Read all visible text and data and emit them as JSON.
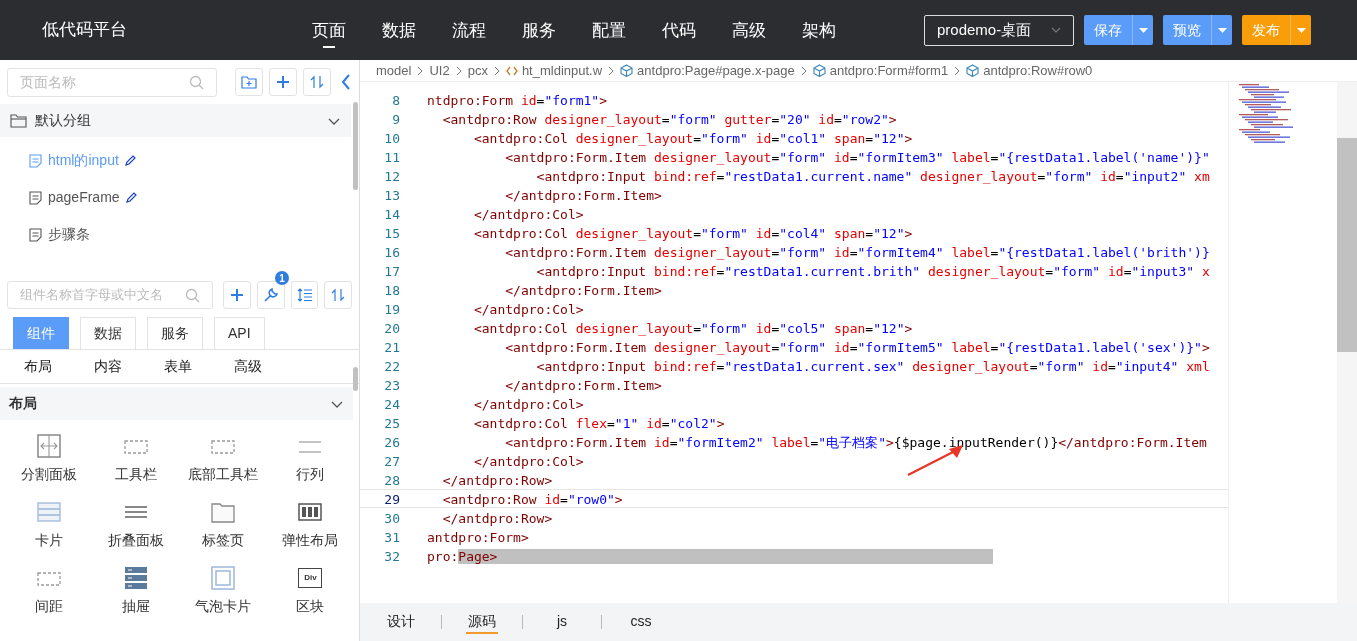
{
  "header": {
    "title": "低代码平台",
    "nav": [
      {
        "label": "页面",
        "selected": true
      },
      {
        "label": "数据",
        "selected": false
      },
      {
        "label": "流程",
        "selected": false
      },
      {
        "label": "服务",
        "selected": false
      },
      {
        "label": "配置",
        "selected": false
      },
      {
        "label": "代码",
        "selected": false
      },
      {
        "label": "高级",
        "selected": false
      },
      {
        "label": "架构",
        "selected": false
      }
    ],
    "project_select": "prodemo-桌面",
    "buttons": [
      {
        "label": "保存",
        "kind": "blue"
      },
      {
        "label": "预览",
        "kind": "blue"
      },
      {
        "label": "发布",
        "kind": "orange"
      }
    ]
  },
  "pages_panel": {
    "search": {
      "placeholder": "页面名称"
    },
    "group": {
      "label": "默认分组",
      "expanded": true,
      "items": [
        {
          "label": "html的input",
          "selected": true,
          "editable": true
        },
        {
          "label": "pageFrame",
          "selected": false,
          "editable": true
        },
        {
          "label": "步骤条",
          "selected": false,
          "editable": false
        }
      ]
    }
  },
  "components_panel": {
    "search": {
      "placeholder": "组件名称首字母或中文名"
    },
    "tool_badge": "1",
    "tabs": [
      {
        "label": "组件",
        "selected": true
      },
      {
        "label": "数据",
        "selected": false
      },
      {
        "label": "服务",
        "selected": false
      },
      {
        "label": "API",
        "selected": false
      }
    ],
    "categories": [
      "布局",
      "内容",
      "表单",
      "高级"
    ],
    "section": {
      "title": "布局",
      "expanded": true,
      "items": [
        {
          "label": "分割面板",
          "kind": "split"
        },
        {
          "label": "工具栏",
          "kind": "dashed"
        },
        {
          "label": "底部工具栏",
          "kind": "dashed"
        },
        {
          "label": "行列",
          "kind": "lines"
        },
        {
          "label": "卡片",
          "kind": "card"
        },
        {
          "label": "折叠面板",
          "kind": "bars"
        },
        {
          "label": "标签页",
          "kind": "folder"
        },
        {
          "label": "弹性布局",
          "kind": "columns"
        },
        {
          "label": "间距",
          "kind": "dashed"
        },
        {
          "label": "抽屉",
          "kind": "drawer"
        },
        {
          "label": "气泡卡片",
          "kind": "frame"
        },
        {
          "label": "区块",
          "kind": "div",
          "icon_text": "Div"
        }
      ]
    }
  },
  "breadcrumb": [
    {
      "label": "model",
      "kind": "plain"
    },
    {
      "label": "UI2",
      "kind": "plain"
    },
    {
      "label": "pcx",
      "kind": "plain"
    },
    {
      "label": "ht_mldinput.w",
      "kind": "file"
    },
    {
      "label": "antdpro:Page#page.x-page",
      "kind": "component"
    },
    {
      "label": "antdpro:Form#form1",
      "kind": "component"
    },
    {
      "label": "antdpro:Row#row0",
      "kind": "component"
    }
  ],
  "editor": {
    "lines": [
      {
        "number": "8",
        "current": false,
        "tokens": [
          {
            "kind": "tag",
            "text": "ntdpro:Form"
          },
          {
            "kind": "attr",
            "text": " id"
          },
          {
            "kind": "text",
            "text": "="
          },
          {
            "kind": "value",
            "text": "\"form1\""
          },
          {
            "kind": "tag",
            "text": ">"
          }
        ]
      },
      {
        "number": "9",
        "current": false,
        "tokens": [
          {
            "kind": "tag",
            "text": "  <antdpro:Row"
          },
          {
            "kind": "attr",
            "text": " designer_layout"
          },
          {
            "kind": "text",
            "text": "="
          },
          {
            "kind": "value",
            "text": "\"form\""
          },
          {
            "kind": "attr",
            "text": " gutter"
          },
          {
            "kind": "text",
            "text": "="
          },
          {
            "kind": "value",
            "text": "\"20\""
          },
          {
            "kind": "attr",
            "text": " id"
          },
          {
            "kind": "text",
            "text": "="
          },
          {
            "kind": "value",
            "text": "\"row2\""
          },
          {
            "kind": "tag",
            "text": ">"
          }
        ]
      },
      {
        "number": "10",
        "current": false,
        "tokens": [
          {
            "kind": "tag",
            "text": "      <antdpro:Col"
          },
          {
            "kind": "attr",
            "text": " designer_layout"
          },
          {
            "kind": "text",
            "text": "="
          },
          {
            "kind": "value",
            "text": "\"form\""
          },
          {
            "kind": "attr",
            "text": " id"
          },
          {
            "kind": "text",
            "text": "="
          },
          {
            "kind": "value",
            "text": "\"col1\""
          },
          {
            "kind": "attr",
            "text": " span"
          },
          {
            "kind": "text",
            "text": "="
          },
          {
            "kind": "value",
            "text": "\"12\""
          },
          {
            "kind": "tag",
            "text": ">"
          }
        ]
      },
      {
        "number": "11",
        "current": false,
        "tokens": [
          {
            "kind": "tag",
            "text": "          <antdpro:Form.Item"
          },
          {
            "kind": "attr",
            "text": " designer_layout"
          },
          {
            "kind": "text",
            "text": "="
          },
          {
            "kind": "value",
            "text": "\"form\""
          },
          {
            "kind": "attr",
            "text": " id"
          },
          {
            "kind": "text",
            "text": "="
          },
          {
            "kind": "value",
            "text": "\"formItem3\""
          },
          {
            "kind": "attr",
            "text": " label"
          },
          {
            "kind": "text",
            "text": "="
          },
          {
            "kind": "value",
            "text": "\"{restData1.label('name')}\""
          }
        ]
      },
      {
        "number": "12",
        "current": false,
        "tokens": [
          {
            "kind": "tag",
            "text": "              <antdpro:Input"
          },
          {
            "kind": "attr",
            "text": " bind:ref"
          },
          {
            "kind": "text",
            "text": "="
          },
          {
            "kind": "value",
            "text": "\"restData1.current.name\""
          },
          {
            "kind": "attr",
            "text": " designer_layout"
          },
          {
            "kind": "text",
            "text": "="
          },
          {
            "kind": "value",
            "text": "\"form\""
          },
          {
            "kind": "attr",
            "text": " id"
          },
          {
            "kind": "text",
            "text": "="
          },
          {
            "kind": "value",
            "text": "\"input2\""
          },
          {
            "kind": "attr",
            "text": " xm"
          }
        ]
      },
      {
        "number": "13",
        "current": false,
        "tokens": [
          {
            "kind": "tag",
            "text": "          </antdpro:Form.Item>"
          }
        ]
      },
      {
        "number": "14",
        "current": false,
        "tokens": [
          {
            "kind": "tag",
            "text": "      </antdpro:Col>"
          }
        ]
      },
      {
        "number": "15",
        "current": false,
        "tokens": [
          {
            "kind": "tag",
            "text": "      <antdpro:Col"
          },
          {
            "kind": "attr",
            "text": " designer_layout"
          },
          {
            "kind": "text",
            "text": "="
          },
          {
            "kind": "value",
            "text": "\"form\""
          },
          {
            "kind": "attr",
            "text": " id"
          },
          {
            "kind": "text",
            "text": "="
          },
          {
            "kind": "value",
            "text": "\"col4\""
          },
          {
            "kind": "attr",
            "text": " span"
          },
          {
            "kind": "text",
            "text": "="
          },
          {
            "kind": "value",
            "text": "\"12\""
          },
          {
            "kind": "tag",
            "text": ">"
          }
        ]
      },
      {
        "number": "16",
        "current": false,
        "tokens": [
          {
            "kind": "tag",
            "text": "          <antdpro:Form.Item"
          },
          {
            "kind": "attr",
            "text": " designer_layout"
          },
          {
            "kind": "text",
            "text": "="
          },
          {
            "kind": "value",
            "text": "\"form\""
          },
          {
            "kind": "attr",
            "text": " id"
          },
          {
            "kind": "text",
            "text": "="
          },
          {
            "kind": "value",
            "text": "\"formItem4\""
          },
          {
            "kind": "attr",
            "text": " label"
          },
          {
            "kind": "text",
            "text": "="
          },
          {
            "kind": "value",
            "text": "\"{restData1.label('brith')}"
          }
        ]
      },
      {
        "number": "17",
        "current": false,
        "tokens": [
          {
            "kind": "tag",
            "text": "              <antdpro:Input"
          },
          {
            "kind": "attr",
            "text": " bind:ref"
          },
          {
            "kind": "text",
            "text": "="
          },
          {
            "kind": "value",
            "text": "\"restData1.current.brith\""
          },
          {
            "kind": "attr",
            "text": " designer_layout"
          },
          {
            "kind": "text",
            "text": "="
          },
          {
            "kind": "value",
            "text": "\"form\""
          },
          {
            "kind": "attr",
            "text": " id"
          },
          {
            "kind": "text",
            "text": "="
          },
          {
            "kind": "value",
            "text": "\"input3\""
          },
          {
            "kind": "attr",
            "text": " x"
          }
        ]
      },
      {
        "number": "18",
        "current": false,
        "tokens": [
          {
            "kind": "tag",
            "text": "          </antdpro:Form.Item>"
          }
        ]
      },
      {
        "number": "19",
        "current": false,
        "tokens": [
          {
            "kind": "tag",
            "text": "      </antdpro:Col>"
          }
        ]
      },
      {
        "number": "20",
        "current": false,
        "tokens": [
          {
            "kind": "tag",
            "text": "      <antdpro:Col"
          },
          {
            "kind": "attr",
            "text": " designer_layout"
          },
          {
            "kind": "text",
            "text": "="
          },
          {
            "kind": "value",
            "text": "\"form\""
          },
          {
            "kind": "attr",
            "text": " id"
          },
          {
            "kind": "text",
            "text": "="
          },
          {
            "kind": "value",
            "text": "\"col5\""
          },
          {
            "kind": "attr",
            "text": " span"
          },
          {
            "kind": "text",
            "text": "="
          },
          {
            "kind": "value",
            "text": "\"12\""
          },
          {
            "kind": "tag",
            "text": ">"
          }
        ]
      },
      {
        "number": "21",
        "current": false,
        "tokens": [
          {
            "kind": "tag",
            "text": "          <antdpro:Form.Item"
          },
          {
            "kind": "attr",
            "text": " designer_layout"
          },
          {
            "kind": "text",
            "text": "="
          },
          {
            "kind": "value",
            "text": "\"form\""
          },
          {
            "kind": "attr",
            "text": " id"
          },
          {
            "kind": "text",
            "text": "="
          },
          {
            "kind": "value",
            "text": "\"formItem5\""
          },
          {
            "kind": "attr",
            "text": " label"
          },
          {
            "kind": "text",
            "text": "="
          },
          {
            "kind": "value",
            "text": "\"{restData1.label('sex')}\""
          },
          {
            "kind": "tag",
            "text": ">"
          }
        ]
      },
      {
        "number": "22",
        "current": false,
        "tokens": [
          {
            "kind": "tag",
            "text": "              <antdpro:Input"
          },
          {
            "kind": "attr",
            "text": " bind:ref"
          },
          {
            "kind": "text",
            "text": "="
          },
          {
            "kind": "value",
            "text": "\"restData1.current.sex\""
          },
          {
            "kind": "attr",
            "text": " designer_layout"
          },
          {
            "kind": "text",
            "text": "="
          },
          {
            "kind": "value",
            "text": "\"form\""
          },
          {
            "kind": "attr",
            "text": " id"
          },
          {
            "kind": "text",
            "text": "="
          },
          {
            "kind": "value",
            "text": "\"input4\""
          },
          {
            "kind": "attr",
            "text": " xml"
          }
        ]
      },
      {
        "number": "23",
        "current": false,
        "tokens": [
          {
            "kind": "tag",
            "text": "          </antdpro:Form.Item>"
          }
        ]
      },
      {
        "number": "24",
        "current": false,
        "tokens": [
          {
            "kind": "tag",
            "text": "      </antdpro:Col>"
          }
        ]
      },
      {
        "number": "25",
        "current": false,
        "tokens": [
          {
            "kind": "tag",
            "text": "      <antdpro:Col"
          },
          {
            "kind": "attr",
            "text": " flex"
          },
          {
            "kind": "text",
            "text": "="
          },
          {
            "kind": "value",
            "text": "\"1\""
          },
          {
            "kind": "attr",
            "text": " id"
          },
          {
            "kind": "text",
            "text": "="
          },
          {
            "kind": "value",
            "text": "\"col2\""
          },
          {
            "kind": "tag",
            "text": ">"
          }
        ]
      },
      {
        "number": "26",
        "current": false,
        "tokens": [
          {
            "kind": "tag",
            "text": "          <antdpro:Form.Item"
          },
          {
            "kind": "attr",
            "text": " id"
          },
          {
            "kind": "text",
            "text": "="
          },
          {
            "kind": "value",
            "text": "\"formItem2\""
          },
          {
            "kind": "attr",
            "text": " label"
          },
          {
            "kind": "text",
            "text": "="
          },
          {
            "kind": "value",
            "text": "\"电子档案\""
          },
          {
            "kind": "tag",
            "text": ">"
          },
          {
            "kind": "text",
            "text": "{$page.inputRender()}"
          },
          {
            "kind": "tag",
            "text": "</antdpro:Form.Item"
          }
        ]
      },
      {
        "number": "27",
        "current": false,
        "tokens": [
          {
            "kind": "tag",
            "text": "      </antdpro:Col>"
          }
        ]
      },
      {
        "number": "28",
        "current": false,
        "tokens": [
          {
            "kind": "tag",
            "text": "  </antdpro:Row>"
          }
        ]
      },
      {
        "number": "29",
        "current": true,
        "tokens": [
          {
            "kind": "tag",
            "text": "  <antdpro:Row"
          },
          {
            "kind": "attr",
            "text": " id"
          },
          {
            "kind": "text",
            "text": "="
          },
          {
            "kind": "value",
            "text": "\"row0\""
          },
          {
            "kind": "tag",
            "text": ">"
          }
        ]
      },
      {
        "number": "30",
        "current": false,
        "tokens": [
          {
            "kind": "tag",
            "text": "  </antdpro:Row>"
          }
        ]
      },
      {
        "number": "31",
        "current": false,
        "tokens": [
          {
            "kind": "tag",
            "text": "antdpro:Form>"
          }
        ]
      },
      {
        "number": "32",
        "current": false,
        "tokens": [
          {
            "kind": "tag",
            "text": "pro:"
          },
          {
            "kind": "selection",
            "text": "Page>"
          }
        ]
      }
    ]
  },
  "bottom_tabs": [
    {
      "label": "设计",
      "selected": false
    },
    {
      "label": "源码",
      "selected": true
    },
    {
      "label": "js",
      "selected": false
    },
    {
      "label": "css",
      "selected": false
    }
  ]
}
